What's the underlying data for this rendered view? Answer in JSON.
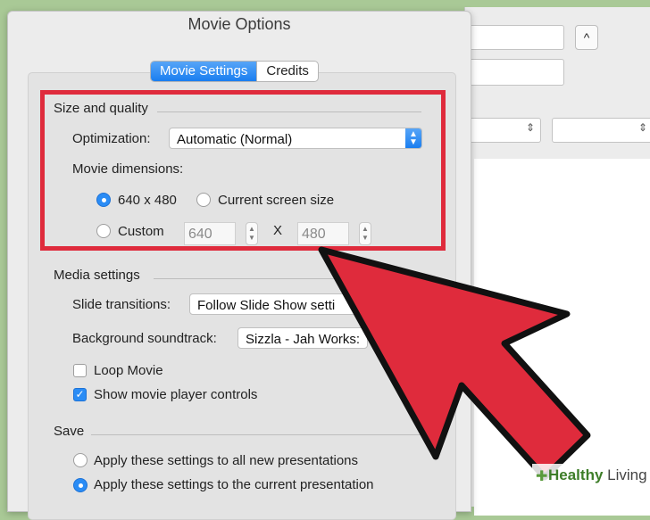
{
  "dialog": {
    "title": "Movie Options",
    "tabs": [
      {
        "label": "Movie Settings",
        "active": true
      },
      {
        "label": "Credits",
        "active": false
      }
    ]
  },
  "size_quality": {
    "heading": "Size and quality",
    "optimization_label": "Optimization:",
    "optimization_value": "Automatic (Normal)",
    "dimensions_label": "Movie dimensions:",
    "options": [
      {
        "label": "640 x 480",
        "selected": true
      },
      {
        "label": "Current screen size",
        "selected": false
      },
      {
        "label": "Custom",
        "selected": false
      }
    ],
    "custom_width": "640",
    "times_label": "X",
    "custom_height": "480"
  },
  "media": {
    "heading": "Media settings",
    "slide_transitions_label": "Slide transitions:",
    "slide_transitions_value": "Follow Slide Show setti",
    "soundtrack_label": "Background soundtrack:",
    "soundtrack_value": "Sizzla - Jah Works:",
    "loop_label": "Loop Movie",
    "loop_checked": false,
    "controls_label": "Show movie player controls",
    "controls_checked": true
  },
  "save": {
    "heading": "Save",
    "option1": "Apply these settings to all new presentations",
    "option2": "Apply these settings to the current presentation"
  },
  "background_window": {
    "button_glyph": "^"
  },
  "watermark": {
    "prefix": "Healthy",
    "suffix": " Living"
  },
  "colors": {
    "highlight_red": "#df2b3c",
    "accent_blue": "#1a7ef0",
    "background_green": "#a9c996"
  }
}
